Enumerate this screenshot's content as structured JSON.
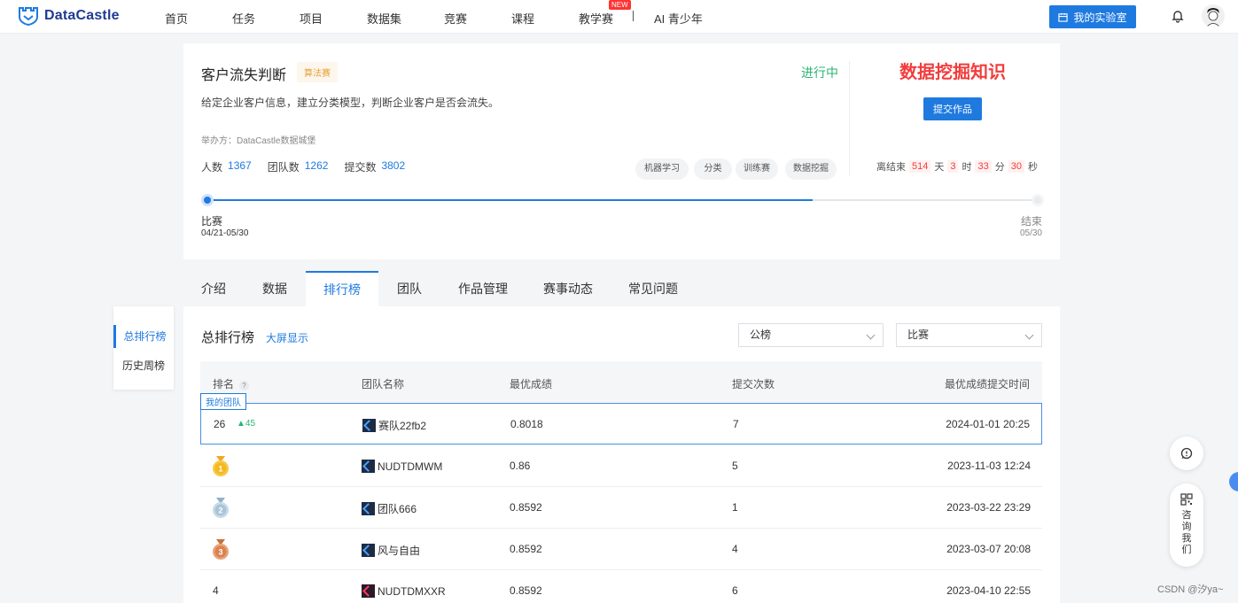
{
  "nav": {
    "brand": "DataCastle",
    "items": [
      "首页",
      "任务",
      "项目",
      "数据集",
      "竞赛",
      "课程",
      "教学赛",
      "AI 青少年"
    ],
    "new_badge": "NEW",
    "lab_button": "我的实验室",
    "icons": [
      "logo-icon",
      "calendar-icon",
      "bell-icon",
      "avatar"
    ]
  },
  "competition": {
    "title": "客户流失判断",
    "tag": "算法赛",
    "status": "进行中",
    "description": "给定企业客户信息，建立分类模型，判断企业客户是否会流失。",
    "host": "举办方：DataCastle数据城堡",
    "stats": [
      {
        "label": "人数",
        "value": "1367"
      },
      {
        "label": "团队数",
        "value": "1262"
      },
      {
        "label": "提交数",
        "value": "3802"
      }
    ],
    "chips": [
      "机器学习",
      "分类",
      "训练赛",
      "数据挖掘"
    ],
    "knowledge_title": "数据挖掘知识",
    "submit_button": "提交作品",
    "countdown": {
      "prefix": "离结束",
      "days": "514",
      "days_unit": "天",
      "hours": "3",
      "hours_unit": "时",
      "minutes": "33",
      "minutes_unit": "分",
      "seconds": "30",
      "seconds_unit": "秒"
    },
    "timeline": {
      "progress": 0.73,
      "start_label": "比赛",
      "start_date": "04/21-05/30",
      "end_label": "结束",
      "end_date": "05/30"
    }
  },
  "tabs": [
    "介绍",
    "数据",
    "排行榜",
    "团队",
    "作品管理",
    "赛事动态",
    "常见问题"
  ],
  "active_tab": "排行榜",
  "side_menu": [
    "总排行榜",
    "历史周榜"
  ],
  "board": {
    "title": "总排行榜",
    "fullscreen_link": "大屏显示",
    "select_board": "公榜",
    "select_stage": "比赛",
    "columns": [
      "排名",
      "团队名称",
      "最优成绩",
      "提交次数",
      "最优成绩提交时间"
    ],
    "help_icon": "?",
    "my_team_badge": "我的团队",
    "my_row": {
      "rank": "26",
      "rise": "▲45",
      "team": "赛队22fb2",
      "score": "0.8018",
      "submissions": "7",
      "time": "2024-01-01 20:25"
    },
    "rows": [
      {
        "rank": "1",
        "medal": "gold",
        "team": "NUDTDMWM",
        "score": "0.86",
        "submissions": "5",
        "time": "2023-11-03 12:24"
      },
      {
        "rank": "2",
        "medal": "silver",
        "team": "团队666",
        "score": "0.8592",
        "submissions": "1",
        "time": "2023-03-22 23:29"
      },
      {
        "rank": "3",
        "medal": "bronze",
        "team": "风与自由",
        "score": "0.8592",
        "submissions": "4",
        "time": "2023-03-07 20:08"
      },
      {
        "rank": "4",
        "medal": "",
        "team": "NUDTDMXXR",
        "score": "0.8592",
        "submissions": "6",
        "time": "2023-04-10 22:55"
      }
    ]
  },
  "floating": {
    "consult_lines": [
      "咨",
      "询",
      "我",
      "们"
    ]
  },
  "watermark": "CSDN @汐ya~"
}
